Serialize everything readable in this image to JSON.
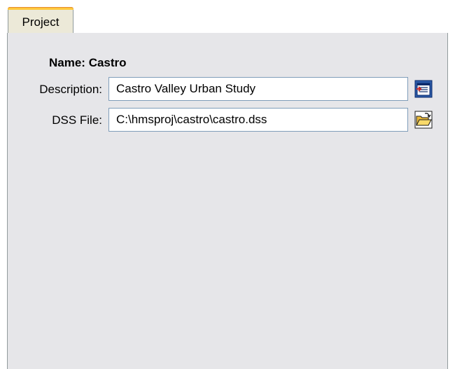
{
  "tabs": [
    {
      "label": "Project",
      "active": true
    }
  ],
  "project": {
    "name_label": "Name:",
    "name_value": "Castro",
    "description_label": "Description:",
    "description_value": "Castro Valley Urban Study",
    "dss_label": "DSS File:",
    "dss_value": "C:\\hmsproj\\castro\\castro.dss"
  },
  "icons": {
    "description_editor": "text-editor-icon",
    "dss_browse": "folder-open-icon"
  },
  "colors": {
    "panel_bg": "#e6e6e9",
    "tab_highlight": "#ffc83c",
    "field_border": "#7f9db9"
  }
}
